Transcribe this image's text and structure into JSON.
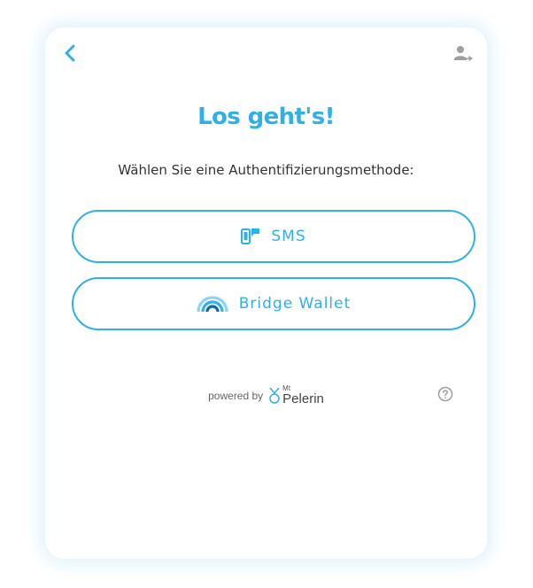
{
  "header": {
    "back_icon": "chevron-left-icon",
    "account_icon": "person-login-icon"
  },
  "main": {
    "title": "Los geht's!",
    "subtitle": "Wählen Sie eine Authentifizierungsmethode:",
    "methods": [
      {
        "label": "SMS",
        "icon": "phone-message-icon"
      },
      {
        "label": "Bridge Wallet",
        "icon": "bridge-wallet-icon"
      }
    ]
  },
  "footer": {
    "powered_by": "powered by",
    "brand_small": "Mt",
    "brand_name": "Pelerin",
    "help_icon": "question-circle-icon"
  },
  "colors": {
    "accent": "#2eb0e8",
    "icon_gray": "#9e9e9e",
    "text": "#333333"
  }
}
